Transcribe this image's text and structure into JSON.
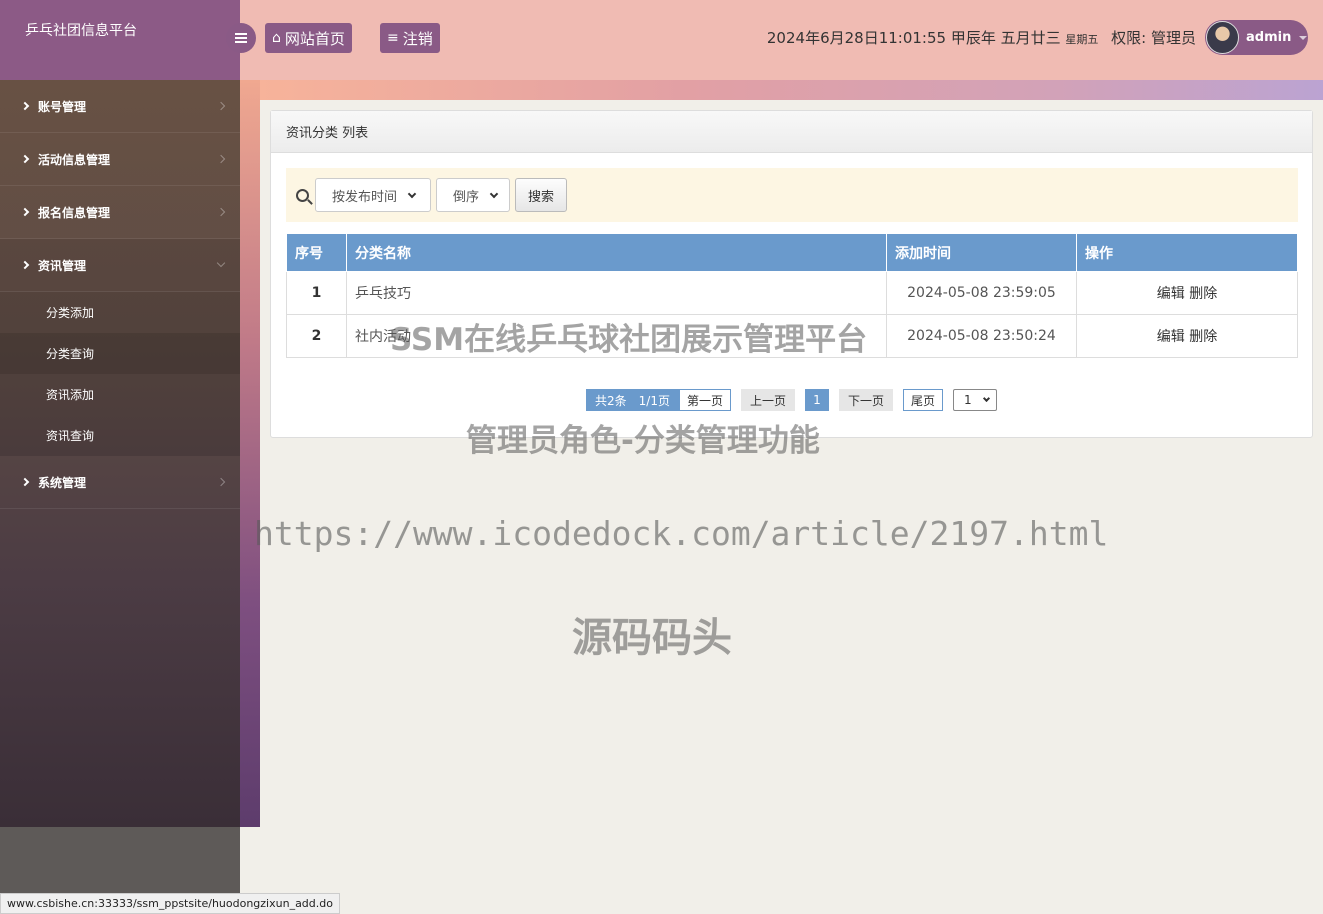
{
  "app": {
    "title": "乒乓社团信息平台"
  },
  "sidebar": {
    "items": [
      {
        "label": "账号管理"
      },
      {
        "label": "活动信息管理"
      },
      {
        "label": "报名信息管理"
      },
      {
        "label": "资讯管理",
        "subitems": [
          {
            "label": "分类添加"
          },
          {
            "label": "分类查询"
          },
          {
            "label": "资讯添加"
          },
          {
            "label": "资讯查询"
          }
        ]
      },
      {
        "label": "系统管理"
      }
    ]
  },
  "header": {
    "home_label": "网站首页",
    "logout_label": "注销",
    "datetime": "2024年6月28日11:01:55 甲辰年 五月廿三",
    "weekday": "星期五",
    "role": "权限: 管理员",
    "username": "admin"
  },
  "panel": {
    "title": "资讯分类 列表"
  },
  "search": {
    "sort_field": "按发布时间",
    "sort_order": "倒序",
    "button": "搜索"
  },
  "table": {
    "headers": [
      "序号",
      "分类名称",
      "添加时间",
      "操作"
    ],
    "rows": [
      {
        "no": "1",
        "name": "乒乓技巧",
        "time": "2024-05-08 23:59:05",
        "edit": "编辑",
        "del": "删除"
      },
      {
        "no": "2",
        "name": "社内活动",
        "time": "2024-05-08 23:50:24",
        "edit": "编辑",
        "del": "删除"
      }
    ]
  },
  "pager": {
    "total": "共2条",
    "pages": "1/1页",
    "first": "第一页",
    "prev": "上一页",
    "current": "1",
    "next": "下一页",
    "last": "尾页",
    "select": "1"
  },
  "watermarks": [
    "SSM在线乒乓球社团展示管理平台",
    "管理员角色-分类管理功能",
    "https://www.icodedock.com/article/2197.html",
    "源码码头"
  ],
  "statusbar": {
    "url": "www.csbishe.cn:33333/ssm_ppstsite/huodongzixun_add.do"
  },
  "icons": {
    "home": "home-icon",
    "logout": "list-icon",
    "menu": "menu-icon",
    "search": "search-icon"
  },
  "colors": {
    "accent": "#8a5a86",
    "table_header": "#6a9acc",
    "topbar": "#f0bbb3"
  }
}
